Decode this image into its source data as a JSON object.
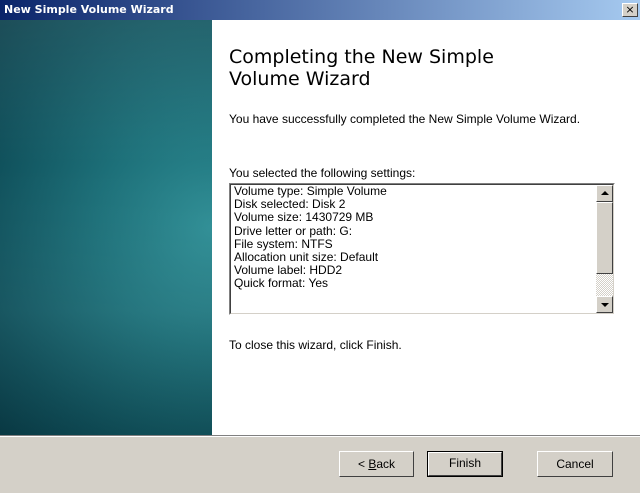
{
  "window": {
    "title": "New Simple Volume Wizard",
    "close_glyph": "×"
  },
  "content": {
    "heading": "Completing the New Simple Volume Wizard",
    "success_message": "You have successfully completed the New Simple Volume Wizard.",
    "settings_label": "You selected the following settings:",
    "settings_lines": [
      "Volume type: Simple Volume",
      "Disk selected: Disk 2",
      "Volume size: 1430729 MB",
      "Drive letter or path: G:",
      "File system: NTFS",
      "Allocation unit size: Default",
      "Volume label: HDD2",
      "Quick format: Yes"
    ],
    "close_instruction": "To close this wizard, click Finish."
  },
  "buttons": {
    "back_prefix": "< ",
    "back_mnemonic": "B",
    "back_rest": "ack",
    "finish": "Finish",
    "cancel": "Cancel"
  },
  "icons": {
    "close": "close-icon",
    "scroll_up": "scroll-up-arrow-icon",
    "scroll_down": "scroll-down-arrow-icon"
  }
}
